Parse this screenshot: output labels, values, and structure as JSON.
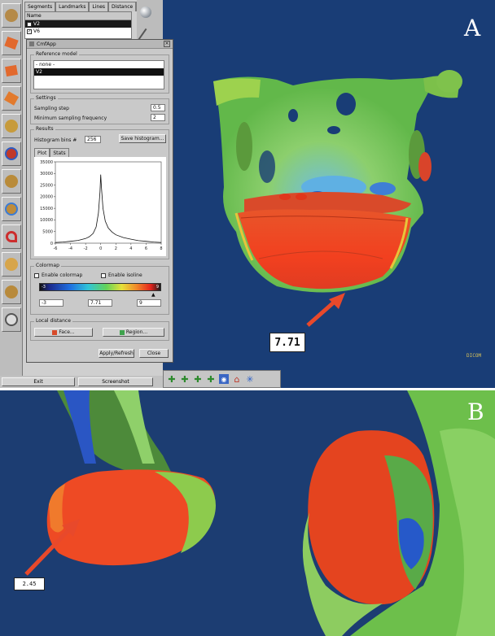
{
  "panels": {
    "a_label": "A",
    "b_label": "B"
  },
  "top_tabs": [
    "Segments",
    "Landmarks",
    "Lines",
    "Distance"
  ],
  "model_list": {
    "header": "Name",
    "rows": [
      {
        "label": "V2",
        "checked": false,
        "selected": true
      },
      {
        "label": "V6",
        "checked": true,
        "selected": false
      }
    ]
  },
  "dialog": {
    "title": "CmfApp",
    "reference_model": {
      "title": "Reference model",
      "items": [
        "- none -",
        "V2"
      ],
      "selected_index": 1
    },
    "settings": {
      "title": "Settings",
      "sampling_step_label": "Sampling step",
      "sampling_step_value": "0.5",
      "min_sampling_label": "Minimum sampling frequency",
      "min_sampling_value": "2"
    },
    "results": {
      "title": "Results",
      "bins_label": "Histogram bins #",
      "bins_value": "256",
      "save_button": "Save histogram...",
      "tabs": [
        "Plot",
        "Stats"
      ]
    },
    "colormap": {
      "title": "Colormap",
      "enable_colormap": "Enable colormap",
      "enable_isoline": "Enable isoline",
      "min_value": "-3",
      "mid_value": "7.71",
      "max_value": "9",
      "bar_left": "-3",
      "bar_right": "9"
    },
    "local_distance": {
      "title": "Local distance",
      "face_button": "Face...",
      "region_button": "Region..."
    },
    "apply_button": "Apply/Refresh",
    "close_button": "Close"
  },
  "bottom_bar": {
    "exit": "Exit",
    "screenshot": "Screenshot"
  },
  "viewport_tag": "DICOM",
  "callout_a": "7.71",
  "callout_b": "2.45",
  "colors": {
    "viewport_bg": "#193d76",
    "arrow": "#e8492b"
  },
  "chart_data": {
    "type": "line",
    "title": "",
    "xlabel": "",
    "ylabel": "",
    "xlim": [
      -6,
      8
    ],
    "ylim": [
      0,
      35000
    ],
    "xticks": [
      -6,
      -4,
      -2,
      0,
      2,
      4,
      6,
      8
    ],
    "yticks": [
      0,
      5000,
      10000,
      15000,
      20000,
      25000,
      30000,
      35000
    ],
    "x": [
      -6,
      -5,
      -4,
      -3,
      -2,
      -1.5,
      -1,
      -0.6,
      -0.3,
      -0.1,
      0,
      0.1,
      0.3,
      0.6,
      1,
      1.5,
      2,
      3,
      4,
      5,
      6,
      7,
      8
    ],
    "y": [
      300,
      500,
      800,
      1200,
      2000,
      2800,
      4200,
      7000,
      13000,
      22000,
      29500,
      24000,
      15000,
      9500,
      6500,
      4800,
      3600,
      2400,
      1700,
      1100,
      800,
      500,
      300
    ]
  }
}
